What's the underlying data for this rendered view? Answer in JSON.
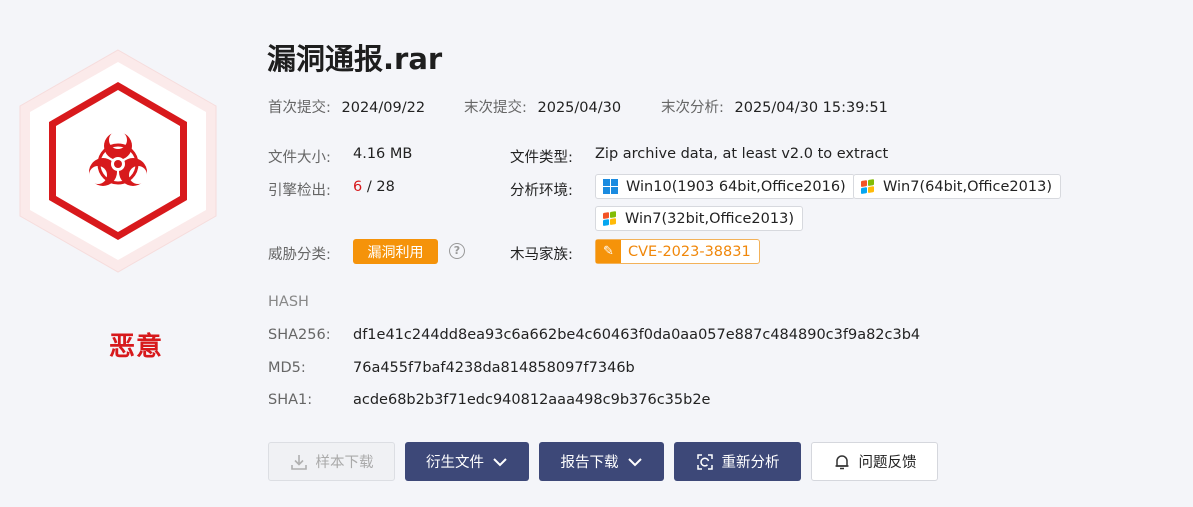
{
  "verdict": {
    "label": "恶意",
    "icon": "biohazard-icon"
  },
  "file": {
    "name": "漏洞通报.rar"
  },
  "meta": [
    {
      "key": "首次提交:",
      "value": "2024/09/22"
    },
    {
      "key": "末次提交:",
      "value": "2025/04/30"
    },
    {
      "key": "末次分析:",
      "value": "2025/04/30 15:39:51"
    }
  ],
  "details": {
    "size_key": "文件大小:",
    "size_value": "4.16 MB",
    "type_key": "文件类型:",
    "type_value": "Zip archive data, at least v2.0 to extract",
    "engines_key": "引擎检出:",
    "engines_detected": "6",
    "engines_sep": " / ",
    "engines_total": "28",
    "env_key": "分析环境:",
    "threat_key": "威胁分类:",
    "threat_value": "漏洞利用",
    "help_glyph": "?",
    "family_key": "木马家族:",
    "family_value": "CVE-2023-38831"
  },
  "environments": [
    {
      "label": "Win10(1903 64bit,Office2016)",
      "icon": "windows10-icon"
    },
    {
      "label": "Win7(64bit,Office2013)",
      "icon": "windows7-icon"
    },
    {
      "label": "Win7(32bit,Office2013)",
      "icon": "windows7-icon"
    }
  ],
  "hash": {
    "heading": "HASH",
    "sha256_key": "SHA256:",
    "sha256": "df1e41c244dd8ea93c6a662be4c60463f0da0aa057e887c484890c3f9a82c3b4",
    "md5_key": "MD5:",
    "md5": "76a455f7baf4238da814858097f7346b",
    "sha1_key": "SHA1:",
    "sha1": "acde68b2b3f71edc940812aaa498c9b376c35b2e"
  },
  "actions": {
    "download_sample": "样本下载",
    "derived_files": "衍生文件",
    "report_download": "报告下载",
    "reanalyze": "重新分析",
    "feedback": "问题反馈"
  },
  "colors": {
    "malicious": "#d7191c",
    "accent_orange": "#f5930a",
    "button_dark": "#3d4878"
  }
}
